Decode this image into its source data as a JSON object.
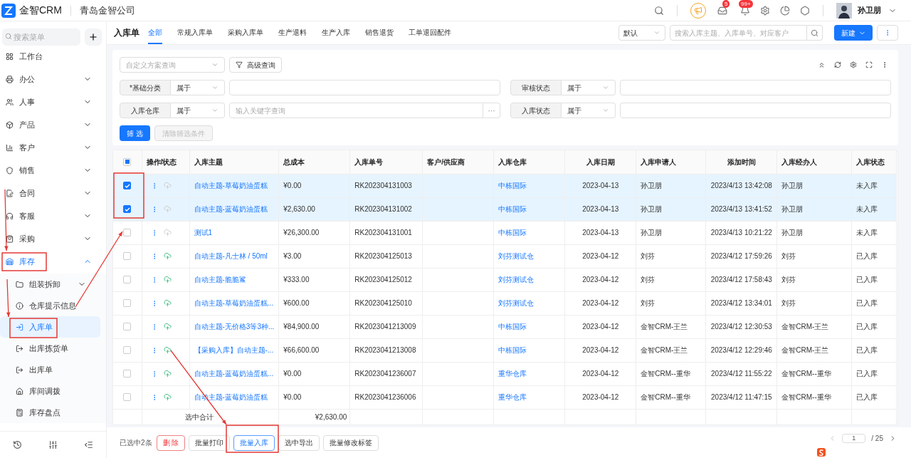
{
  "header": {
    "brand": "金智CRM",
    "company": "青岛金智公司",
    "badges": [
      "5",
      "99+"
    ],
    "user": "孙卫朋"
  },
  "sidebar": {
    "search_placeholder": "搜索菜单",
    "items": [
      {
        "label": "工作台",
        "selected": false
      },
      {
        "label": "办公",
        "expanded": false,
        "selected": false
      },
      {
        "label": "人事",
        "expanded": false,
        "selected": false
      },
      {
        "label": "产品",
        "expanded": false,
        "selected": false
      },
      {
        "label": "客户",
        "expanded": false,
        "selected": false
      },
      {
        "label": "销售",
        "expanded": false,
        "selected": false
      },
      {
        "label": "合同",
        "expanded": false,
        "selected": false
      },
      {
        "label": "客服",
        "expanded": false,
        "selected": false
      },
      {
        "label": "采购",
        "expanded": false,
        "selected": false
      },
      {
        "label": "库存",
        "expanded": true,
        "selected": true,
        "children": [
          {
            "label": "组装拆卸",
            "expanded": false,
            "selected": false
          },
          {
            "label": "仓库提示信息",
            "selected": false
          },
          {
            "label": "入库单",
            "selected": true
          },
          {
            "label": "出库拣货单",
            "selected": false
          },
          {
            "label": "出库单",
            "selected": false
          },
          {
            "label": "库间调拨",
            "selected": false
          },
          {
            "label": "库存盘点",
            "selected": false
          }
        ]
      }
    ]
  },
  "page": {
    "title": "入库单",
    "tabs": [
      {
        "label": "全部",
        "selected": true
      },
      {
        "label": "常规入库单",
        "selected": false
      },
      {
        "label": "采购入库单",
        "selected": false
      },
      {
        "label": "生产退料",
        "selected": false
      },
      {
        "label": "生产入库",
        "selected": false
      },
      {
        "label": "销售退货",
        "selected": false
      },
      {
        "label": "工单退回配件",
        "selected": false
      }
    ],
    "view_select": "默认",
    "search_placeholder": "搜索入库主题、入库单号、对应客户",
    "new_button": "新建"
  },
  "filters": {
    "scheme_placeholder": "自定义方案查询",
    "advanced_button": "高级查询",
    "rows": [
      [
        {
          "label": "*基础分类",
          "operator": "属于",
          "kind": "plain"
        },
        {
          "label": "审核状态",
          "operator": "属于",
          "kind": "plain"
        }
      ],
      [
        {
          "label": "入库仓库",
          "operator": "属于",
          "kind": "picker",
          "placeholder": "输入关键字查询",
          "picker_button": "···"
        },
        {
          "label": "入库状态",
          "operator": "属于",
          "kind": "plain"
        }
      ]
    ],
    "apply_button": "筛 选",
    "clear_button": "清除筛选条件",
    "clear_disabled": true
  },
  "table": {
    "all_checked": false,
    "some_checked": true,
    "columns": [
      "操作/状态",
      "入库主题",
      "总成本",
      "入库单号",
      "客户/供应商",
      "入库仓库",
      "入库日期",
      "入库申请人",
      "添加时间",
      "入库经办人",
      "入库状态"
    ],
    "rows": [
      {
        "selected": true,
        "entered": false,
        "subject": "自动主题-草莓奶油蛋糕",
        "cost": "¥0.00",
        "number": "RK202304131003",
        "warehouse": "中栋国际",
        "date": "2023-04-13",
        "applicant": "孙卫朋",
        "added": "2023/4/13 13:42:08",
        "handler": "孙卫朋",
        "status": "未入库"
      },
      {
        "selected": true,
        "entered": false,
        "subject": "自动主题-蓝莓奶油蛋糕",
        "cost": "¥2,630.00",
        "number": "RK202304131002",
        "warehouse": "中栋国际",
        "date": "2023-04-13",
        "applicant": "孙卫朋",
        "added": "2023/4/13 13:41:52",
        "handler": "孙卫朋",
        "status": "未入库"
      },
      {
        "selected": false,
        "entered": false,
        "subject": "测试1",
        "cost": "¥26,300.00",
        "number": "RK202304131001",
        "warehouse": "中栋国际",
        "date": "2023-04-13",
        "applicant": "孙卫朋",
        "added": "2023/4/13 10:21:22",
        "handler": "孙卫朋",
        "status": "未入库"
      },
      {
        "selected": false,
        "entered": true,
        "subject": "自动主题-凡士林 / 50ml",
        "cost": "¥3.00",
        "number": "RK202304125013",
        "warehouse": "刘芬测试仓",
        "date": "2023-04-12",
        "applicant": "刘芬",
        "added": "2023/4/12 17:59:26",
        "handler": "刘芬",
        "status": "已入库"
      },
      {
        "selected": false,
        "entered": true,
        "subject": "自动主题-脆脆鲨",
        "cost": "¥333.00",
        "number": "RK202304125012",
        "warehouse": "刘芬测试仓",
        "date": "2023-04-12",
        "applicant": "刘芬",
        "added": "2023/4/12 17:58:43",
        "handler": "刘芬",
        "status": "已入库"
      },
      {
        "selected": false,
        "entered": true,
        "subject": "自动主题-草莓奶油蛋糕...",
        "cost": "¥600.00",
        "number": "RK202304125010",
        "warehouse": "刘芬测试仓",
        "date": "2023-04-12",
        "applicant": "刘芬",
        "added": "2023/4/12 13:34:01",
        "handler": "刘芬",
        "status": "已入库"
      },
      {
        "selected": false,
        "entered": true,
        "subject": "自动主题-无价格3等3种...",
        "cost": "¥84,900.00",
        "number": "RK2023041213009",
        "warehouse": "中栋国际",
        "date": "2023-04-12",
        "applicant": "金智CRM-王兰",
        "added": "2023/4/12 12:30:53",
        "handler": "金智CRM-王兰",
        "status": "已入库"
      },
      {
        "selected": false,
        "entered": true,
        "subject": "【采购入库】自动主题-...",
        "cost": "¥66,600.00",
        "number": "RK2023041213008",
        "warehouse": "中栋国际",
        "date": "2023-04-12",
        "applicant": "金智CRM-王兰",
        "added": "2023/4/12 12:29:46",
        "handler": "金智CRM-王兰",
        "status": "已入库"
      },
      {
        "selected": false,
        "entered": true,
        "subject": "自动主题-蓝莓奶油蛋糕...",
        "cost": "¥0.00",
        "number": "RK2023041236007",
        "warehouse": "重华仓库",
        "date": "2023-04-12",
        "applicant": "金智CRM--重华",
        "added": "2023/4/12 11:55:22",
        "handler": "金智CRM--重华",
        "status": "已入库"
      },
      {
        "selected": false,
        "entered": true,
        "subject": "自动主题-蓝莓奶油蛋糕",
        "cost": "¥0.00",
        "number": "RK2023041236006",
        "warehouse": "重华仓库",
        "date": "2023-04-12",
        "applicant": "金智CRM--重华",
        "added": "2023/4/12 11:47:15",
        "handler": "金智CRM--重华",
        "status": "已入库"
      }
    ],
    "summary": {
      "label": "选中合计",
      "cost": "¥2,630.00"
    }
  },
  "footer": {
    "selected_count": "已选中2条",
    "buttons": [
      {
        "label": "删 除",
        "kind": "danger"
      },
      {
        "label": "批量打印",
        "kind": "default"
      },
      {
        "label": "批量入库",
        "kind": "primary"
      },
      {
        "label": "选中导出",
        "kind": "default"
      },
      {
        "label": "批量修改标签",
        "kind": "default"
      }
    ],
    "page": "1",
    "total_pages": "/ 25"
  },
  "annotation_overlay": true
}
